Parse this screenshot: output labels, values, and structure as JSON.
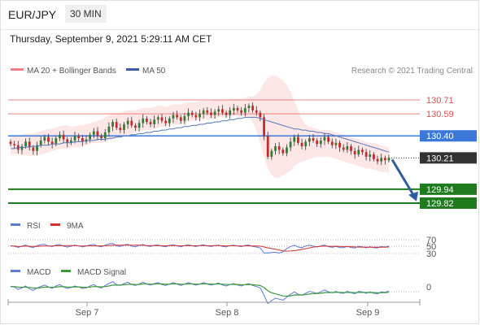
{
  "header": {
    "pair": "EUR/JPY",
    "timeframe": "30 MIN",
    "datetime": "Thursday, September 9, 2021 5:29:11 AM CET"
  },
  "legend": {
    "bb": "MA 20 + Bollinger Bands",
    "ma50": "MA 50",
    "credit": "Research © 2021 Trading Central",
    "rsi": "RSI",
    "ma9": "9MA",
    "macd": "MACD",
    "macd_signal": "MACD Signal"
  },
  "levels": [
    {
      "value": "130.71",
      "kind": "resistance",
      "color": "#f08080"
    },
    {
      "value": "130.59",
      "kind": "resistance",
      "color": "#f08080"
    },
    {
      "value": "130.40",
      "kind": "pivot",
      "color": "#3c78d8"
    },
    {
      "value": "130.21",
      "kind": "last",
      "color": "#333333"
    },
    {
      "value": "129.94",
      "kind": "support",
      "color": "#1e7b1e"
    },
    {
      "value": "129.82",
      "kind": "support",
      "color": "#1e7b1e"
    }
  ],
  "x_labels": [
    "Sep 7",
    "Sep 8",
    "Sep 9"
  ],
  "rsi_ticks": [
    "70",
    "50",
    "30"
  ],
  "macd_ticks": [
    "0"
  ],
  "colors": {
    "up": "#2e7d32",
    "down": "#c62828",
    "bb_fill": "#fde2e2",
    "ma50": "#5577bb",
    "rsi": "#5b7bd5",
    "rsi_ma": "#d32f2f",
    "macd": "#5b7bd5",
    "signal": "#3a9a3a"
  },
  "chart_data": {
    "type": "candlestick",
    "title": "EUR/JPY 30 MIN",
    "ylim": [
      129.7,
      130.8
    ],
    "x": [
      "Sep 7",
      "Sep 8",
      "Sep 9"
    ],
    "close": [
      130.33,
      130.32,
      130.28,
      130.31,
      130.35,
      130.3,
      130.27,
      130.32,
      130.36,
      130.39,
      130.35,
      130.33,
      130.38,
      130.41,
      130.37,
      130.34,
      130.36,
      130.4,
      130.38,
      130.35,
      130.37,
      130.41,
      130.44,
      130.4,
      130.38,
      130.43,
      130.48,
      130.52,
      130.47,
      130.45,
      130.5,
      130.53,
      130.49,
      130.47,
      130.51,
      130.55,
      130.52,
      130.5,
      130.54,
      130.56,
      130.53,
      130.51,
      130.55,
      130.58,
      130.56,
      130.53,
      130.57,
      130.6,
      130.58,
      130.56,
      130.59,
      130.62,
      130.6,
      130.58,
      130.61,
      130.63,
      130.6,
      130.58,
      130.62,
      130.64,
      130.62,
      130.6,
      130.64,
      130.66,
      130.62,
      130.6,
      130.56,
      130.4,
      130.22,
      130.27,
      130.31,
      130.28,
      130.25,
      130.3,
      130.35,
      130.39,
      130.34,
      130.31,
      130.35,
      130.38,
      130.36,
      130.33,
      130.36,
      130.39,
      130.35,
      130.32,
      130.34,
      130.3,
      130.28,
      130.31,
      130.27,
      130.24,
      130.28,
      130.26,
      130.22,
      130.24,
      130.2,
      130.18,
      130.21,
      130.19,
      130.21
    ],
    "open": [
      130.35,
      130.33,
      130.32,
      130.28,
      130.31,
      130.35,
      130.3,
      130.27,
      130.32,
      130.36,
      130.39,
      130.35,
      130.33,
      130.38,
      130.41,
      130.37,
      130.34,
      130.36,
      130.4,
      130.38,
      130.35,
      130.37,
      130.41,
      130.44,
      130.4,
      130.38,
      130.43,
      130.48,
      130.52,
      130.47,
      130.45,
      130.5,
      130.53,
      130.49,
      130.47,
      130.51,
      130.55,
      130.52,
      130.5,
      130.54,
      130.56,
      130.53,
      130.51,
      130.55,
      130.58,
      130.56,
      130.53,
      130.57,
      130.6,
      130.58,
      130.56,
      130.59,
      130.62,
      130.6,
      130.58,
      130.61,
      130.63,
      130.6,
      130.58,
      130.62,
      130.64,
      130.62,
      130.6,
      130.64,
      130.66,
      130.62,
      130.6,
      130.56,
      130.4,
      130.22,
      130.27,
      130.31,
      130.28,
      130.25,
      130.3,
      130.35,
      130.39,
      130.34,
      130.31,
      130.35,
      130.38,
      130.36,
      130.33,
      130.36,
      130.39,
      130.35,
      130.32,
      130.34,
      130.3,
      130.28,
      130.31,
      130.27,
      130.24,
      130.28,
      130.26,
      130.22,
      130.24,
      130.2,
      130.18,
      130.21,
      130.19
    ],
    "ma50": [
      130.29,
      130.29,
      130.3,
      130.3,
      130.3,
      130.31,
      130.31,
      130.31,
      130.32,
      130.32,
      130.32,
      130.33,
      130.33,
      130.33,
      130.34,
      130.34,
      130.34,
      130.35,
      130.35,
      130.35,
      130.36,
      130.36,
      130.36,
      130.37,
      130.37,
      130.37,
      130.38,
      130.38,
      130.39,
      130.39,
      130.4,
      130.4,
      130.41,
      130.41,
      130.42,
      130.42,
      130.43,
      130.43,
      130.44,
      130.44,
      130.45,
      130.45,
      130.46,
      130.46,
      130.47,
      130.47,
      130.48,
      130.48,
      130.49,
      130.49,
      130.5,
      130.5,
      130.51,
      130.51,
      130.52,
      130.52,
      130.53,
      130.53,
      130.54,
      130.54,
      130.55,
      130.55,
      130.56,
      130.56,
      130.56,
      130.56,
      130.55,
      130.54,
      130.53,
      130.52,
      130.51,
      130.5,
      130.49,
      130.48,
      130.47,
      130.46,
      130.46,
      130.45,
      130.45,
      130.44,
      130.44,
      130.43,
      130.43,
      130.42,
      130.42,
      130.41,
      130.4,
      130.39,
      130.38,
      130.37,
      130.36,
      130.35,
      130.34,
      130.33,
      130.32,
      130.31,
      130.3,
      130.29,
      130.28,
      130.27,
      130.26
    ],
    "bb_upper": [
      130.4,
      130.4,
      130.4,
      130.41,
      130.42,
      130.42,
      130.42,
      130.43,
      130.44,
      130.45,
      130.46,
      130.46,
      130.47,
      130.48,
      130.49,
      130.49,
      130.48,
      130.48,
      130.49,
      130.49,
      130.5,
      130.51,
      130.52,
      130.53,
      130.54,
      130.56,
      130.58,
      130.6,
      130.6,
      130.6,
      130.61,
      130.62,
      130.62,
      130.62,
      130.63,
      130.64,
      130.64,
      130.64,
      130.65,
      130.66,
      130.66,
      130.65,
      130.66,
      130.67,
      130.67,
      130.67,
      130.68,
      130.69,
      130.69,
      130.69,
      130.7,
      130.7,
      130.7,
      130.7,
      130.71,
      130.71,
      130.71,
      130.71,
      130.72,
      130.72,
      130.72,
      130.72,
      130.73,
      130.74,
      130.74,
      130.76,
      130.8,
      130.86,
      130.9,
      130.92,
      130.92,
      130.9,
      130.88,
      130.84,
      130.78,
      130.7,
      130.62,
      130.54,
      130.5,
      130.48,
      130.47,
      130.46,
      130.45,
      130.45,
      130.45,
      130.44,
      130.43,
      130.42,
      130.41,
      130.4,
      130.39,
      130.38,
      130.37,
      130.36,
      130.35,
      130.34,
      130.34,
      130.33,
      130.32,
      130.31,
      130.3
    ],
    "bb_lower": [
      130.24,
      130.24,
      130.24,
      130.23,
      130.23,
      130.23,
      130.23,
      130.23,
      130.24,
      130.25,
      130.26,
      130.27,
      130.28,
      130.29,
      130.29,
      130.29,
      130.3,
      130.3,
      130.3,
      130.31,
      130.32,
      130.33,
      130.34,
      130.34,
      130.34,
      130.35,
      130.36,
      130.37,
      130.38,
      130.39,
      130.4,
      130.41,
      130.42,
      130.43,
      130.44,
      130.45,
      130.45,
      130.45,
      130.46,
      130.47,
      130.48,
      130.48,
      130.49,
      130.5,
      130.5,
      130.5,
      130.51,
      130.52,
      130.53,
      130.53,
      130.54,
      130.54,
      130.54,
      130.55,
      130.55,
      130.56,
      130.56,
      130.56,
      130.57,
      130.57,
      130.57,
      130.57,
      130.57,
      130.56,
      130.52,
      130.44,
      130.34,
      130.22,
      130.12,
      130.06,
      130.04,
      130.04,
      130.06,
      130.08,
      130.1,
      130.14,
      130.16,
      130.18,
      130.19,
      130.2,
      130.21,
      130.22,
      130.22,
      130.22,
      130.22,
      130.21,
      130.2,
      130.19,
      130.18,
      130.17,
      130.16,
      130.15,
      130.14,
      130.13,
      130.12,
      130.12,
      130.11,
      130.1,
      130.09,
      130.09,
      130.08
    ],
    "forecast": {
      "from": 130.21,
      "to": 129.85
    }
  }
}
